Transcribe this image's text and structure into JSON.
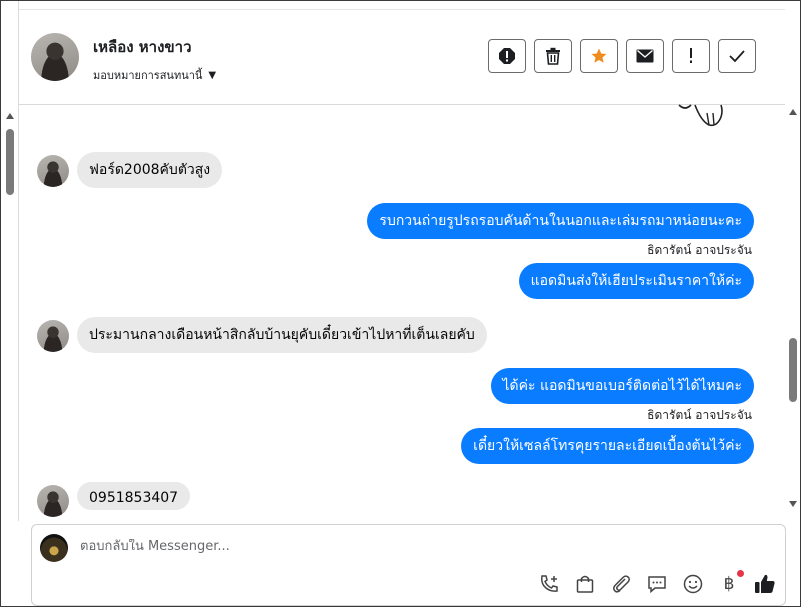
{
  "header": {
    "contact_name": "เหลือง หางขาว",
    "assign_label": "มอบหมายการสนทนานี้",
    "actions": [
      "spam-icon",
      "trash-icon",
      "star-icon",
      "mail-icon",
      "exclamation-icon",
      "check-icon"
    ]
  },
  "colors": {
    "outgoing": "#0a7cff",
    "incoming": "#e9e9e9",
    "star": "#f08c1e"
  },
  "messages": [
    {
      "side": "in",
      "text": "ฟอร์ด2008คับตัวสูง"
    },
    {
      "side": "out",
      "text": "รบกวนถ่ายรูปรถรอบคันด้านในนอกและเล่มรถมาหน่อยนะคะ"
    },
    {
      "side": "note",
      "text": "ธิดารัตน์ อาจประจัน"
    },
    {
      "side": "out",
      "text": "แอดมินส่งให้เฮียประเมินราคาให้ค่ะ"
    },
    {
      "side": "in",
      "text": "ประมานกลางเดือนหน้าสิกลับบ้านยุคับเดี๋ยวเข้าไปหาที่เต็นเลยคับ"
    },
    {
      "side": "out",
      "text": "ได้ค่ะ แอดมินขอเบอร์ติดต่อไว้ได้ไหมคะ"
    },
    {
      "side": "note",
      "text": "ธิดารัตน์ อาจประจัน"
    },
    {
      "side": "out",
      "text": "เดี๋ยวให้เซลล์โทรคุยรายละเอียดเบื้องต้นไว้ค่ะ"
    },
    {
      "side": "in",
      "text": "0951853407"
    }
  ],
  "composer": {
    "placeholder": "ตอบกลับใน Messenger...",
    "tools": [
      "phone-add-icon",
      "shopping-bag-icon",
      "paperclip-icon",
      "saved-reply-icon",
      "emoji-icon",
      "baht-icon",
      "thumbs-up-icon"
    ],
    "baht_symbol": "฿"
  }
}
